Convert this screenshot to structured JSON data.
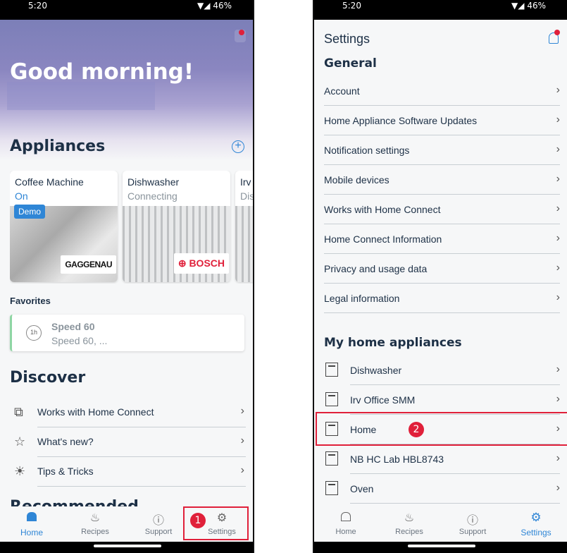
{
  "left": {
    "status": {
      "time": "5:20",
      "battery": "46%"
    },
    "greeting": "Good morning!",
    "appliances_title": "Appliances",
    "appliances": [
      {
        "name": "Coffee Machine",
        "state": "On",
        "badge": "Demo",
        "brand": "GAGGENAU"
      },
      {
        "name": "Dishwasher",
        "state": "Connecting",
        "brand": "BOSCH"
      },
      {
        "name": "Irv O",
        "state": "Dis"
      }
    ],
    "favorites_title": "Favorites",
    "favorite": {
      "title": "Speed 60",
      "subtitle": "Speed 60, ...",
      "timer_text": "1h"
    },
    "discover_title": "Discover",
    "discover_items": [
      {
        "label": "Works with Home Connect",
        "icon": "puzzle-icon"
      },
      {
        "label": "What's new?",
        "icon": "star-icon"
      },
      {
        "label": "Tips & Tricks",
        "icon": "lightbulb-icon"
      }
    ],
    "recommended_title": "Recommended",
    "tabs": [
      {
        "label": "Home",
        "active": true
      },
      {
        "label": "Recipes",
        "active": false
      },
      {
        "label": "Support",
        "active": false
      },
      {
        "label": "Settings",
        "active": false
      }
    ],
    "marker": "1"
  },
  "right": {
    "status": {
      "time": "5:20",
      "battery": "46%"
    },
    "title": "Settings",
    "general_title": "General",
    "general_items": [
      "Account",
      "Home Appliance Software Updates",
      "Notification settings",
      "Mobile devices",
      "Works with Home Connect",
      "Home Connect Information",
      "Privacy and usage data",
      "Legal information"
    ],
    "appliances_title": "My home appliances",
    "appliance_items": [
      "Dishwasher",
      "Irv Office SMM",
      "Home",
      "NB HC Lab HBL8743",
      "Oven"
    ],
    "tabs": [
      {
        "label": "Home",
        "active": false
      },
      {
        "label": "Recipes",
        "active": false
      },
      {
        "label": "Support",
        "active": false
      },
      {
        "label": "Settings",
        "active": true
      }
    ],
    "marker": "2"
  },
  "colors": {
    "accent": "#2f86d6",
    "highlight": "#e0203a",
    "text": "#1d3046"
  }
}
